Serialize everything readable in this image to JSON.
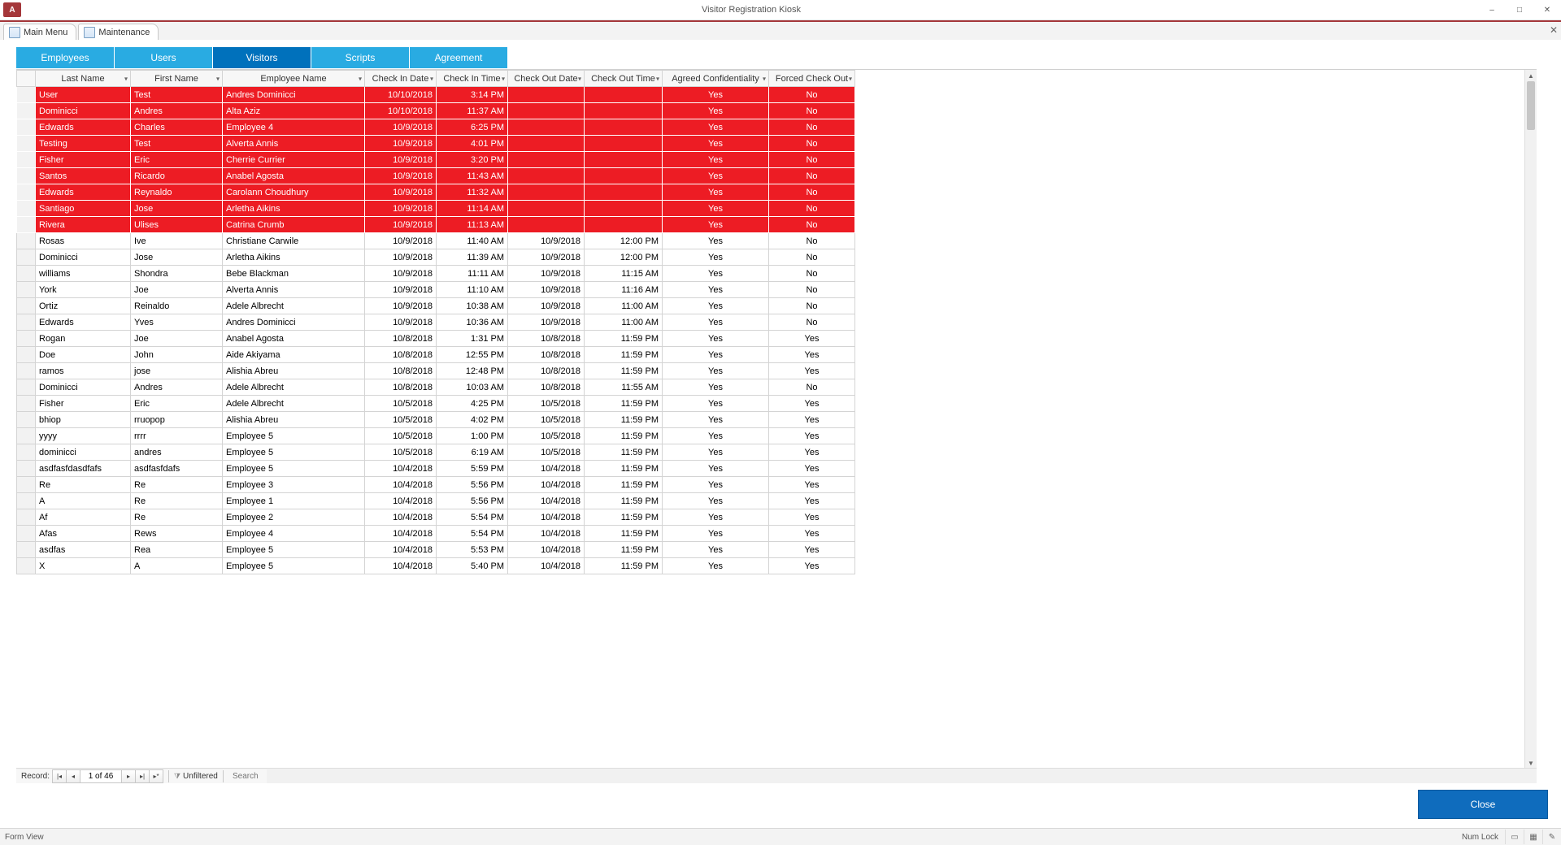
{
  "window": {
    "title": "Visitor Registration Kiosk",
    "app_icon_text": "A"
  },
  "doc_tabs": [
    {
      "label": "Main Menu"
    },
    {
      "label": "Maintenance"
    }
  ],
  "subtabs": {
    "employees": "Employees",
    "users": "Users",
    "visitors": "Visitors",
    "scripts": "Scripts",
    "agreement": "Agreement"
  },
  "columns": {
    "last_name": "Last Name",
    "first_name": "First Name",
    "employee_name": "Employee Name",
    "check_in_date": "Check In Date",
    "check_in_time": "Check In Time",
    "check_out_date": "Check Out Date",
    "check_out_time": "Check Out Time",
    "agreed": "Agreed Confidentiality",
    "forced": "Forced Check Out"
  },
  "rows": [
    {
      "red": true,
      "last": "User",
      "first": "Test",
      "emp": "Andres Dominicci",
      "cid": "10/10/2018",
      "cit": "3:14 PM",
      "cod": "",
      "cot": "",
      "ag": "Yes",
      "fo": "No"
    },
    {
      "red": true,
      "last": "Dominicci",
      "first": "Andres",
      "emp": "Alta Aziz",
      "cid": "10/10/2018",
      "cit": "11:37 AM",
      "cod": "",
      "cot": "",
      "ag": "Yes",
      "fo": "No"
    },
    {
      "red": true,
      "last": "Edwards",
      "first": "Charles",
      "emp": "Employee 4",
      "cid": "10/9/2018",
      "cit": "6:25 PM",
      "cod": "",
      "cot": "",
      "ag": "Yes",
      "fo": "No"
    },
    {
      "red": true,
      "last": "Testing",
      "first": "Test",
      "emp": "Alverta Annis",
      "cid": "10/9/2018",
      "cit": "4:01 PM",
      "cod": "",
      "cot": "",
      "ag": "Yes",
      "fo": "No"
    },
    {
      "red": true,
      "last": "Fisher",
      "first": "Eric",
      "emp": "Cherrie Currier",
      "cid": "10/9/2018",
      "cit": "3:20 PM",
      "cod": "",
      "cot": "",
      "ag": "Yes",
      "fo": "No"
    },
    {
      "red": true,
      "last": "Santos",
      "first": "Ricardo",
      "emp": "Anabel Agosta",
      "cid": "10/9/2018",
      "cit": "11:43 AM",
      "cod": "",
      "cot": "",
      "ag": "Yes",
      "fo": "No"
    },
    {
      "red": true,
      "last": "Edwards",
      "first": "Reynaldo",
      "emp": "Carolann Choudhury",
      "cid": "10/9/2018",
      "cit": "11:32 AM",
      "cod": "",
      "cot": "",
      "ag": "Yes",
      "fo": "No"
    },
    {
      "red": true,
      "last": "Santiago",
      "first": "Jose",
      "emp": "Arletha Aikins",
      "cid": "10/9/2018",
      "cit": "11:14 AM",
      "cod": "",
      "cot": "",
      "ag": "Yes",
      "fo": "No"
    },
    {
      "red": true,
      "last": "Rivera",
      "first": "Ulises",
      "emp": "Catrina Crumb",
      "cid": "10/9/2018",
      "cit": "11:13 AM",
      "cod": "",
      "cot": "",
      "ag": "Yes",
      "fo": "No"
    },
    {
      "red": false,
      "last": "Rosas",
      "first": "Ive",
      "emp": "Christiane Carwile",
      "cid": "10/9/2018",
      "cit": "11:40 AM",
      "cod": "10/9/2018",
      "cot": "12:00 PM",
      "ag": "Yes",
      "fo": "No"
    },
    {
      "red": false,
      "last": "Dominicci",
      "first": "Jose",
      "emp": "Arletha Aikins",
      "cid": "10/9/2018",
      "cit": "11:39 AM",
      "cod": "10/9/2018",
      "cot": "12:00 PM",
      "ag": "Yes",
      "fo": "No"
    },
    {
      "red": false,
      "last": "williams",
      "first": "Shondra",
      "emp": "Bebe Blackman",
      "cid": "10/9/2018",
      "cit": "11:11 AM",
      "cod": "10/9/2018",
      "cot": "11:15 AM",
      "ag": "Yes",
      "fo": "No"
    },
    {
      "red": false,
      "last": "York",
      "first": "Joe",
      "emp": "Alverta Annis",
      "cid": "10/9/2018",
      "cit": "11:10 AM",
      "cod": "10/9/2018",
      "cot": "11:16 AM",
      "ag": "Yes",
      "fo": "No"
    },
    {
      "red": false,
      "last": "Ortiz",
      "first": "Reinaldo",
      "emp": "Adele Albrecht",
      "cid": "10/9/2018",
      "cit": "10:38 AM",
      "cod": "10/9/2018",
      "cot": "11:00 AM",
      "ag": "Yes",
      "fo": "No"
    },
    {
      "red": false,
      "last": "Edwards",
      "first": "Yves",
      "emp": "Andres Dominicci",
      "cid": "10/9/2018",
      "cit": "10:36 AM",
      "cod": "10/9/2018",
      "cot": "11:00 AM",
      "ag": "Yes",
      "fo": "No"
    },
    {
      "red": false,
      "last": "Rogan",
      "first": "Joe",
      "emp": "Anabel Agosta",
      "cid": "10/8/2018",
      "cit": "1:31 PM",
      "cod": "10/8/2018",
      "cot": "11:59 PM",
      "ag": "Yes",
      "fo": "Yes"
    },
    {
      "red": false,
      "last": "Doe",
      "first": "John",
      "emp": "Aide Akiyama",
      "cid": "10/8/2018",
      "cit": "12:55 PM",
      "cod": "10/8/2018",
      "cot": "11:59 PM",
      "ag": "Yes",
      "fo": "Yes"
    },
    {
      "red": false,
      "last": "ramos",
      "first": "jose",
      "emp": "Alishia Abreu",
      "cid": "10/8/2018",
      "cit": "12:48 PM",
      "cod": "10/8/2018",
      "cot": "11:59 PM",
      "ag": "Yes",
      "fo": "Yes"
    },
    {
      "red": false,
      "last": "Dominicci",
      "first": "Andres",
      "emp": "Adele Albrecht",
      "cid": "10/8/2018",
      "cit": "10:03 AM",
      "cod": "10/8/2018",
      "cot": "11:55 AM",
      "ag": "Yes",
      "fo": "No"
    },
    {
      "red": false,
      "last": "Fisher",
      "first": "Eric",
      "emp": "Adele Albrecht",
      "cid": "10/5/2018",
      "cit": "4:25 PM",
      "cod": "10/5/2018",
      "cot": "11:59 PM",
      "ag": "Yes",
      "fo": "Yes"
    },
    {
      "red": false,
      "last": "bhiop",
      "first": "rruopop",
      "emp": "Alishia Abreu",
      "cid": "10/5/2018",
      "cit": "4:02 PM",
      "cod": "10/5/2018",
      "cot": "11:59 PM",
      "ag": "Yes",
      "fo": "Yes"
    },
    {
      "red": false,
      "last": "yyyy",
      "first": "rrrr",
      "emp": "Employee 5",
      "cid": "10/5/2018",
      "cit": "1:00 PM",
      "cod": "10/5/2018",
      "cot": "11:59 PM",
      "ag": "Yes",
      "fo": "Yes"
    },
    {
      "red": false,
      "last": "dominicci",
      "first": "andres",
      "emp": "Employee 5",
      "cid": "10/5/2018",
      "cit": "6:19 AM",
      "cod": "10/5/2018",
      "cot": "11:59 PM",
      "ag": "Yes",
      "fo": "Yes"
    },
    {
      "red": false,
      "last": "asdfasfdasdfafs",
      "first": "asdfasfdafs",
      "emp": "Employee 5",
      "cid": "10/4/2018",
      "cit": "5:59 PM",
      "cod": "10/4/2018",
      "cot": "11:59 PM",
      "ag": "Yes",
      "fo": "Yes"
    },
    {
      "red": false,
      "last": "Re",
      "first": "Re",
      "emp": "Employee 3",
      "cid": "10/4/2018",
      "cit": "5:56 PM",
      "cod": "10/4/2018",
      "cot": "11:59 PM",
      "ag": "Yes",
      "fo": "Yes"
    },
    {
      "red": false,
      "last": "A",
      "first": "Re",
      "emp": "Employee 1",
      "cid": "10/4/2018",
      "cit": "5:56 PM",
      "cod": "10/4/2018",
      "cot": "11:59 PM",
      "ag": "Yes",
      "fo": "Yes"
    },
    {
      "red": false,
      "last": "Af",
      "first": "Re",
      "emp": "Employee 2",
      "cid": "10/4/2018",
      "cit": "5:54 PM",
      "cod": "10/4/2018",
      "cot": "11:59 PM",
      "ag": "Yes",
      "fo": "Yes"
    },
    {
      "red": false,
      "last": "Afas",
      "first": "Rews",
      "emp": "Employee 4",
      "cid": "10/4/2018",
      "cit": "5:54 PM",
      "cod": "10/4/2018",
      "cot": "11:59 PM",
      "ag": "Yes",
      "fo": "Yes"
    },
    {
      "red": false,
      "last": "asdfas",
      "first": "Rea",
      "emp": "Employee 5",
      "cid": "10/4/2018",
      "cit": "5:53 PM",
      "cod": "10/4/2018",
      "cot": "11:59 PM",
      "ag": "Yes",
      "fo": "Yes"
    },
    {
      "red": false,
      "last": "X",
      "first": "A",
      "emp": "Employee 5",
      "cid": "10/4/2018",
      "cit": "5:40 PM",
      "cod": "10/4/2018",
      "cot": "11:59 PM",
      "ag": "Yes",
      "fo": "Yes"
    }
  ],
  "recnav": {
    "label": "Record:",
    "position": "1 of 46",
    "filter": "Unfiltered",
    "search_placeholder": "Search"
  },
  "close_button": "Close",
  "statusbar": {
    "left": "Form View",
    "numlock": "Num Lock"
  }
}
